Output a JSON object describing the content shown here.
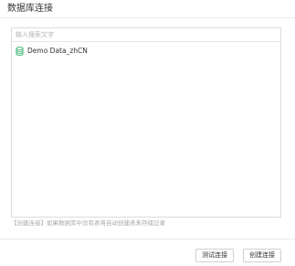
{
  "dialog": {
    "title": "数据库连接"
  },
  "search": {
    "placeholder": "输入搜索文字",
    "value": ""
  },
  "databases": [
    {
      "label": "Demo Data_zhCN",
      "icon": "database-icon"
    }
  ],
  "hint": "【创建连接】如果数据库中没有表将自动创建表来存储记录",
  "buttons": {
    "test_label": "测试连接",
    "create_label": "创建连接"
  },
  "colors": {
    "database_icon": "#3cb371",
    "border": "#dcdcdc",
    "hint_text": "#a8a8a8"
  }
}
